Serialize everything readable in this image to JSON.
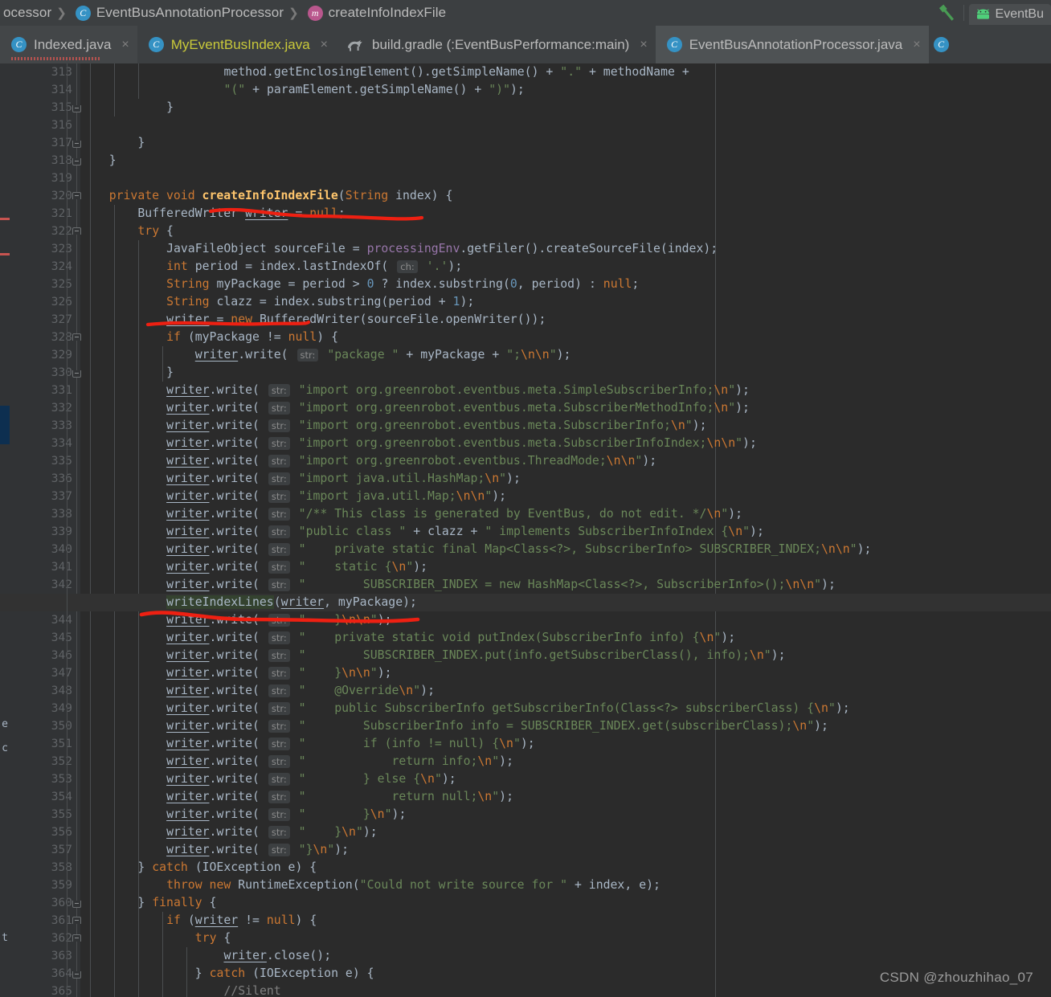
{
  "window": {
    "breadcrumb": [
      {
        "text": "ocessor",
        "icon": null
      },
      {
        "text": "EventBusAnnotationProcessor",
        "icon": "class-icon",
        "badge": "C"
      },
      {
        "text": "createInfoIndexFile",
        "icon": "method-icon",
        "badge": "m"
      }
    ],
    "toolbar": {
      "build_icon": "hammer-icon",
      "run_config": "EventBu",
      "run_config_icon": "android-icon"
    },
    "watermark": "CSDN @zhouzhihao_07"
  },
  "tabs": [
    {
      "label": "Indexed.java",
      "icon": "java-class-icon",
      "active": false,
      "color": "#bbbbbb",
      "close": "×",
      "error_underline": true
    },
    {
      "label": "MyEventBusIndex.java",
      "icon": "java-class-icon",
      "active": false,
      "color": "#c9c93a",
      "close": "×",
      "error_underline": false
    },
    {
      "label": "build.gradle (:EventBusPerformance:main)",
      "icon": "gradle-icon",
      "active": false,
      "color": "#bbbbbb",
      "close": "×",
      "error_underline": false
    },
    {
      "label": "EventBusAnnotationProcessor.java",
      "icon": "java-class-icon",
      "active": true,
      "color": "#bbbbbb",
      "close": "×",
      "error_underline": false
    }
  ],
  "editor": {
    "first_line": 313,
    "current_line": 343,
    "lines": [
      {
        "n": 313,
        "fold": null,
        "text": "                    method.getEnclosingElement().getSimpleName() + \".\" + methodName +"
      },
      {
        "n": 314,
        "fold": null,
        "text": "                    \"(\" + paramElement.getSimpleName() + \")\");"
      },
      {
        "n": 315,
        "fold": "close",
        "text": "            }"
      },
      {
        "n": 316,
        "fold": null,
        "text": ""
      },
      {
        "n": 317,
        "fold": "close",
        "text": "        }"
      },
      {
        "n": 318,
        "fold": "close",
        "text": "    }"
      },
      {
        "n": 319,
        "fold": null,
        "text": ""
      },
      {
        "n": 320,
        "fold": "open",
        "text": "    private void createInfoIndexFile(String index) {"
      },
      {
        "n": 321,
        "fold": null,
        "text": "        BufferedWriter writer = null;"
      },
      {
        "n": 322,
        "fold": "open",
        "text": "        try {"
      },
      {
        "n": 323,
        "fold": null,
        "text": "            JavaFileObject sourceFile = processingEnv.getFiler().createSourceFile(index);"
      },
      {
        "n": 324,
        "fold": null,
        "text": "            int period = index.lastIndexOf( ch: '.');"
      },
      {
        "n": 325,
        "fold": null,
        "text": "            String myPackage = period > 0 ? index.substring(0, period) : null;"
      },
      {
        "n": 326,
        "fold": null,
        "text": "            String clazz = index.substring(period + 1);"
      },
      {
        "n": 327,
        "fold": null,
        "text": "            writer = new BufferedWriter(sourceFile.openWriter());"
      },
      {
        "n": 328,
        "fold": "open",
        "text": "            if (myPackage != null) {"
      },
      {
        "n": 329,
        "fold": null,
        "text": "                writer.write( str: \"package \" + myPackage + \";\\n\\n\");"
      },
      {
        "n": 330,
        "fold": "close",
        "text": "            }"
      },
      {
        "n": 331,
        "fold": null,
        "text": "            writer.write( str: \"import org.greenrobot.eventbus.meta.SimpleSubscriberInfo;\\n\");"
      },
      {
        "n": 332,
        "fold": null,
        "text": "            writer.write( str: \"import org.greenrobot.eventbus.meta.SubscriberMethodInfo;\\n\");"
      },
      {
        "n": 333,
        "fold": null,
        "text": "            writer.write( str: \"import org.greenrobot.eventbus.meta.SubscriberInfo;\\n\");"
      },
      {
        "n": 334,
        "fold": null,
        "text": "            writer.write( str: \"import org.greenrobot.eventbus.meta.SubscriberInfoIndex;\\n\\n\");"
      },
      {
        "n": 335,
        "fold": null,
        "text": "            writer.write( str: \"import org.greenrobot.eventbus.ThreadMode;\\n\\n\");"
      },
      {
        "n": 336,
        "fold": null,
        "text": "            writer.write( str: \"import java.util.HashMap;\\n\");"
      },
      {
        "n": 337,
        "fold": null,
        "text": "            writer.write( str: \"import java.util.Map;\\n\\n\");"
      },
      {
        "n": 338,
        "fold": null,
        "text": "            writer.write( str: \"/** This class is generated by EventBus, do not edit. */\\n\");"
      },
      {
        "n": 339,
        "fold": null,
        "text": "            writer.write( str: \"public class \" + clazz + \" implements SubscriberInfoIndex {\\n\");"
      },
      {
        "n": 340,
        "fold": null,
        "text": "            writer.write( str: \"    private static final Map<Class<?>, SubscriberInfo> SUBSCRIBER_INDEX;\\n\\n\");"
      },
      {
        "n": 341,
        "fold": null,
        "text": "            writer.write( str: \"    static {\\n\");"
      },
      {
        "n": 342,
        "fold": null,
        "text": "            writer.write( str: \"        SUBSCRIBER_INDEX = new HashMap<Class<?>, SubscriberInfo>();\\n\\n\");"
      },
      {
        "n": 343,
        "fold": null,
        "text": "            writeIndexLines(writer, myPackage);"
      },
      {
        "n": 344,
        "fold": null,
        "text": "            writer.write( str: \"    }\\n\\n\");"
      },
      {
        "n": 345,
        "fold": null,
        "text": "            writer.write( str: \"    private static void putIndex(SubscriberInfo info) {\\n\");"
      },
      {
        "n": 346,
        "fold": null,
        "text": "            writer.write( str: \"        SUBSCRIBER_INDEX.put(info.getSubscriberClass(), info);\\n\");"
      },
      {
        "n": 347,
        "fold": null,
        "text": "            writer.write( str: \"    }\\n\\n\");"
      },
      {
        "n": 348,
        "fold": null,
        "text": "            writer.write( str: \"    @Override\\n\");"
      },
      {
        "n": 349,
        "fold": null,
        "text": "            writer.write( str: \"    public SubscriberInfo getSubscriberInfo(Class<?> subscriberClass) {\\n\");"
      },
      {
        "n": 350,
        "fold": null,
        "text": "            writer.write( str: \"        SubscriberInfo info = SUBSCRIBER_INDEX.get(subscriberClass);\\n\");"
      },
      {
        "n": 351,
        "fold": null,
        "text": "            writer.write( str: \"        if (info != null) {\\n\");"
      },
      {
        "n": 352,
        "fold": null,
        "text": "            writer.write( str: \"            return info;\\n\");"
      },
      {
        "n": 353,
        "fold": null,
        "text": "            writer.write( str: \"        } else {\\n\");"
      },
      {
        "n": 354,
        "fold": null,
        "text": "            writer.write( str: \"            return null;\\n\");"
      },
      {
        "n": 355,
        "fold": null,
        "text": "            writer.write( str: \"        }\\n\");"
      },
      {
        "n": 356,
        "fold": null,
        "text": "            writer.write( str: \"    }\\n\");"
      },
      {
        "n": 357,
        "fold": null,
        "text": "            writer.write( str: \"}\\n\");"
      },
      {
        "n": 358,
        "fold": null,
        "text": "        } catch (IOException e) {"
      },
      {
        "n": 359,
        "fold": null,
        "text": "            throw new RuntimeException(\"Could not write source for \" + index, e);"
      },
      {
        "n": 360,
        "fold": "close",
        "text": "        } finally {"
      },
      {
        "n": 361,
        "fold": "open",
        "text": "            if (writer != null) {"
      },
      {
        "n": 362,
        "fold": "open",
        "text": "                try {"
      },
      {
        "n": 363,
        "fold": null,
        "text": "                    writer.close();"
      },
      {
        "n": 364,
        "fold": "close",
        "text": "                } catch (IOException e) {"
      },
      {
        "n": 365,
        "fold": null,
        "text": "                    //Silent"
      }
    ]
  },
  "colors": {
    "background": "#2b2b2b",
    "gutter": "#313335",
    "chrome": "#3c3f41",
    "active_tab": "#4e5254",
    "keyword": "#cc7832",
    "string": "#6a8759",
    "number": "#6897bb",
    "field": "#9876aa",
    "method": "#ffc66d",
    "text": "#a9b7c6",
    "comment": "#808080",
    "current_line": "#323232",
    "annotation_pen": "#e8201f"
  }
}
